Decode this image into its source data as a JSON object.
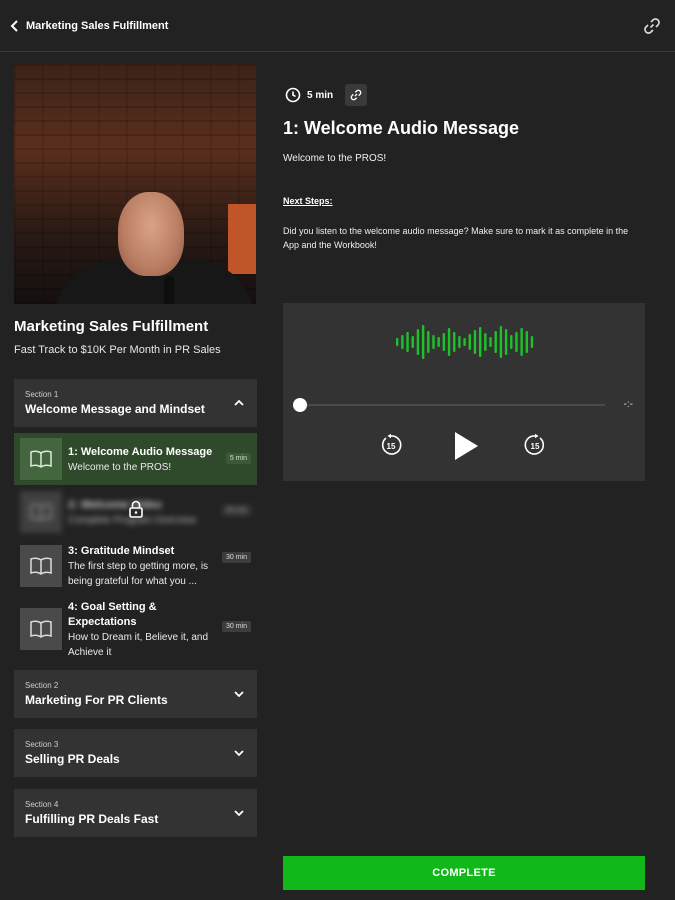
{
  "header": {
    "title": "Marketing Sales Fulfillment"
  },
  "course": {
    "title": "Marketing Sales Fulfillment",
    "subtitle": "Fast Track to $10K Per Month in PR Sales"
  },
  "sections": [
    {
      "number": "Section 1",
      "title": "Welcome Message and Mindset",
      "expanded": true,
      "lessons": [
        {
          "title": "1: Welcome Audio Message",
          "description": "Welcome to the PROS!",
          "duration": "5 min",
          "active": true,
          "locked": false
        },
        {
          "title": "2: Welcome Video",
          "description": "Complete Program Overview",
          "duration": "30 min",
          "active": false,
          "locked": true
        },
        {
          "title": "3: Gratitude Mindset",
          "description": "The first step to getting more, is being grateful for what you ...",
          "duration": "30 min",
          "active": false,
          "locked": false
        },
        {
          "title": "4: Goal Setting & Expectations",
          "description": "How to Dream it, Believe it, and Achieve it",
          "duration": "30 min",
          "active": false,
          "locked": false
        }
      ]
    },
    {
      "number": "Section 2",
      "title": "Marketing For PR Clients",
      "expanded": false
    },
    {
      "number": "Section 3",
      "title": "Selling PR Deals",
      "expanded": false
    },
    {
      "number": "Section 4",
      "title": "Fulfilling PR Deals Fast",
      "expanded": false
    }
  ],
  "lesson": {
    "duration": "5 min",
    "heading": "1: Welcome Audio Message",
    "intro": "Welcome to the PROS!",
    "next_steps_label": "Next Steps:",
    "next_steps_body": "Did you listen to the welcome audio message? Make sure to mark it as complete in the App and the Workbook!"
  },
  "player": {
    "time_remaining": "-:-",
    "progress": 0,
    "rewind_label": "15",
    "forward_label": "15",
    "wave_color": "#1fc12a"
  },
  "actions": {
    "complete_label": "COMPLETE"
  },
  "colors": {
    "accent": "#10b81a",
    "active_lesson_bg": "#2e4a2b",
    "background": "#222222",
    "panel": "#333333"
  }
}
